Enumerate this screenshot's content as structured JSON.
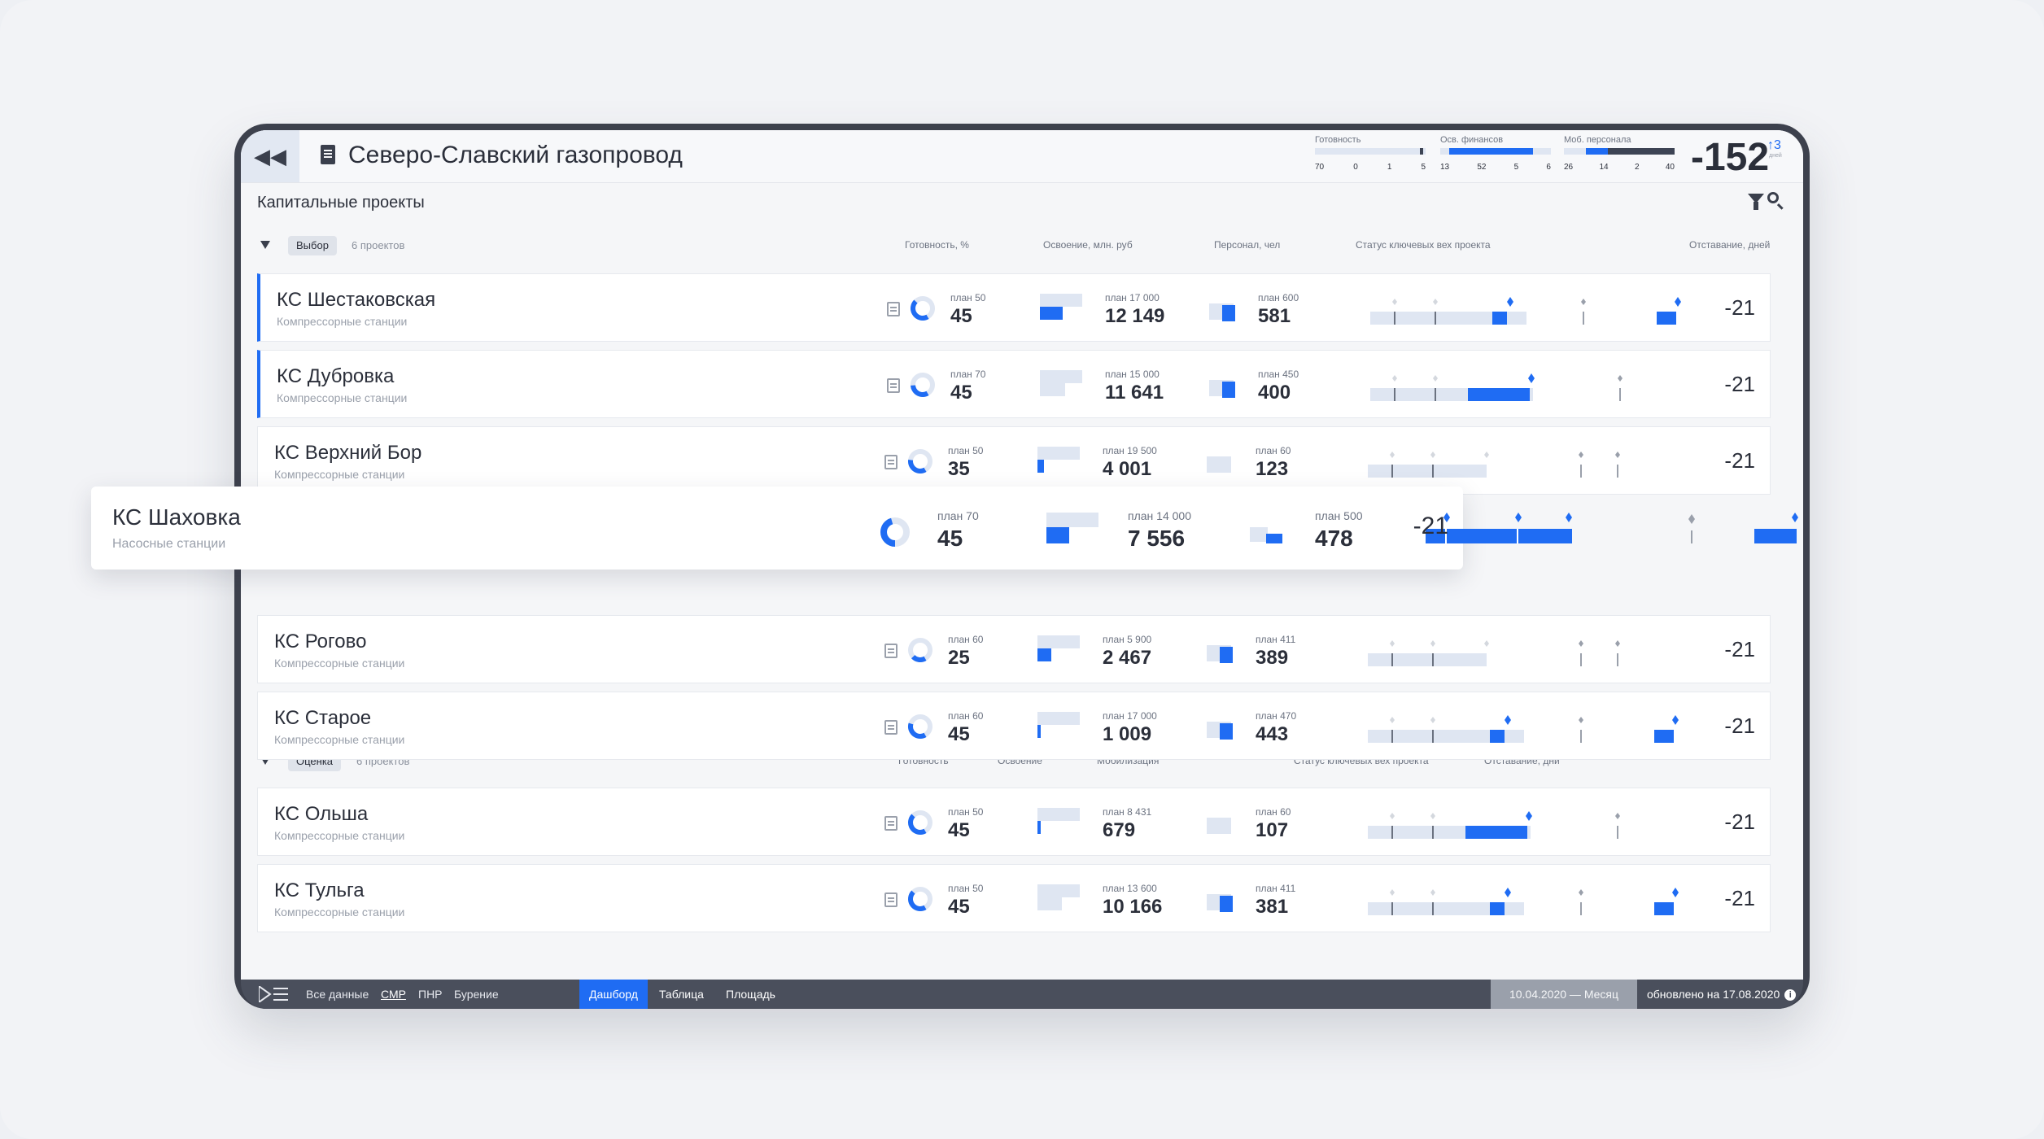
{
  "header": {
    "back_icon": "double-chevron-left-icon",
    "title": "Северо-Славский газопровод",
    "kpis": [
      {
        "label": "Готовность",
        "ticks": [
          "70",
          "0",
          "1",
          "5"
        ],
        "fill": [
          0.0,
          0.0
        ],
        "mark": 0.96
      },
      {
        "label": "Осв. финансов",
        "ticks": [
          "13",
          "52",
          "5",
          "6"
        ],
        "fill": [
          0.08,
          0.84
        ]
      },
      {
        "label": "Моб. персонала",
        "ticks": [
          "26",
          "14",
          "2",
          "40"
        ],
        "fill": [
          0.4,
          0.9
        ]
      }
    ],
    "score": "-152",
    "score_delta": "↑3",
    "score_units": "дней"
  },
  "section": {
    "title": "Капитальные проекты"
  },
  "groups": [
    {
      "tag": "Выбор",
      "count": "6 проектов",
      "columns": [
        "Готовность, %",
        "Освоение, млн. руб",
        "Персонал, чел",
        "Статус ключевых вех проекта",
        "Отставание, дней"
      ]
    },
    {
      "tag": "Оценка",
      "count": "6 проектов",
      "columns": [
        "Готовность",
        "Освоение",
        "Мобилизация",
        "Статус ключевых вех проекта",
        "Отставание, дни"
      ]
    }
  ],
  "rows": [
    {
      "name": "КС Шестаковская",
      "sub": "Компрессорные станции",
      "ready_plan": "план 50",
      "ready": "45",
      "fin_plan": "план 17 000",
      "fin": "12 149",
      "staff_plan": "план 600",
      "staff": "581",
      "lag": "-21"
    },
    {
      "name": "КС Дубровка",
      "sub": "Компрессорные станции",
      "ready_plan": "план 70",
      "ready": "45",
      "fin_plan": "план 15 000",
      "fin": "11 641",
      "staff_plan": "план 450",
      "staff": "400",
      "lag": "-21"
    },
    {
      "name": "КС Верхний Бор",
      "sub": "Компрессорные станции",
      "ready_plan": "план 50",
      "ready": "35",
      "fin_plan": "план 19 500",
      "fin": "4 001",
      "staff_plan": "план 60",
      "staff": "123",
      "lag": "-21"
    },
    {
      "name": "КС Рогово",
      "sub": "Компрессорные станции",
      "ready_plan": "план 60",
      "ready": "25",
      "fin_plan": "план 5 900",
      "fin": "2 467",
      "staff_plan": "план 411",
      "staff": "389",
      "lag": "-21"
    },
    {
      "name": "КС Старое",
      "sub": "Компрессорные станции",
      "ready_plan": "план 60",
      "ready": "45",
      "fin_plan": "план 17 000",
      "fin": "1 009",
      "staff_plan": "план 470",
      "staff": "443",
      "lag": "-21"
    },
    {
      "name": "КС Ольша",
      "sub": "Компрессорные станции",
      "ready_plan": "план 50",
      "ready": "45",
      "fin_plan": "план 8 431",
      "fin": "679",
      "staff_plan": "план 60",
      "staff": "107",
      "lag": "-21"
    },
    {
      "name": "КС Тульга",
      "sub": "Компрессорные станции",
      "ready_plan": "план 50",
      "ready": "45",
      "fin_plan": "план 13 600",
      "fin": "10 166",
      "staff_plan": "план 411",
      "staff": "381",
      "lag": "-21"
    }
  ],
  "popup": {
    "name": "КС Шаховка",
    "sub": "Насосные станции",
    "ready_plan": "план 70",
    "ready": "45",
    "fin_plan": "план 14 000",
    "fin": "7 556",
    "staff_plan": "план 500",
    "staff": "478",
    "lag": "-21"
  },
  "footer": {
    "logo_icon": "app-logo-icon",
    "filters": [
      "Все данные",
      "СМР",
      "ПНР",
      "Бурение"
    ],
    "tabs": [
      "Дашборд",
      "Таблица",
      "Площадь"
    ],
    "period": "10.04.2020 — Месяц",
    "updated": "обновлено на 17.08.2020",
    "info_icon": "info-icon"
  },
  "colors": {
    "accent": "#1f6cf3",
    "track": "#dfe6f2",
    "text": "#2b2f3a",
    "muted": "#9aa0ab"
  }
}
